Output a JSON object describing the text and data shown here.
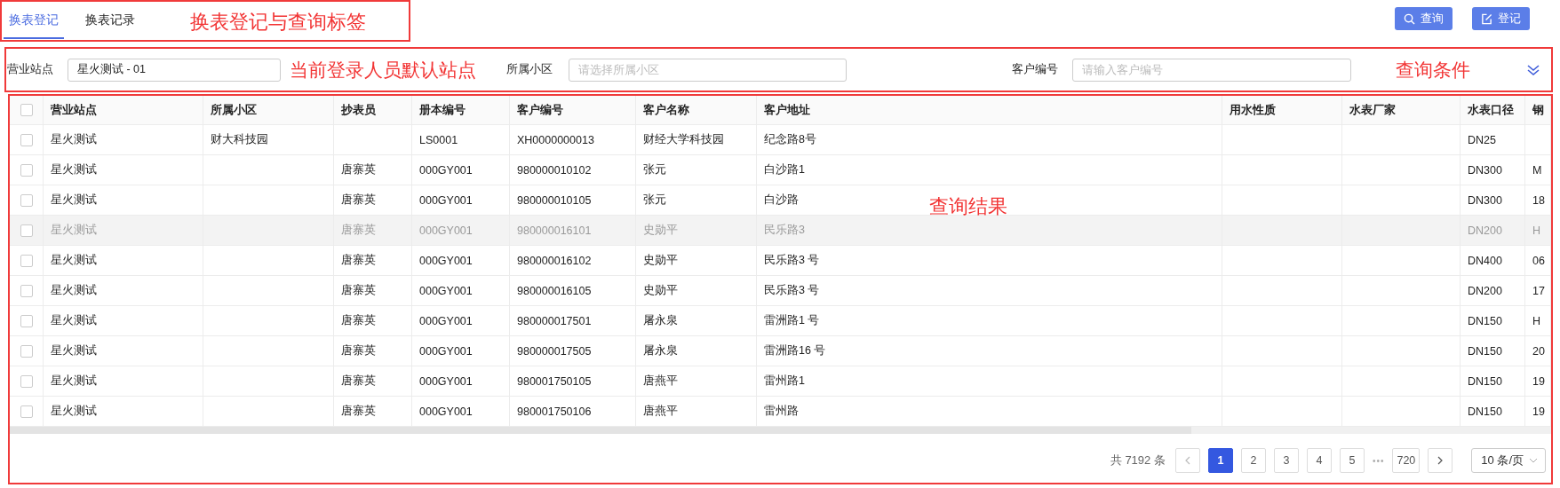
{
  "tab_bar": {
    "tabs": [
      {
        "label": "换表登记",
        "selected": true
      },
      {
        "label": "换表记录",
        "selected": false
      }
    ],
    "annotation": "换表登记与查询标签"
  },
  "buttons": [
    {
      "label": "查询",
      "kind": "search"
    },
    {
      "label": "登记",
      "kind": "register"
    }
  ],
  "filter_bar": {
    "filters": [
      {
        "label": "营业站点",
        "kind": "select",
        "value": "星火测试 - 01",
        "annotation": "当前登录人员默认站点"
      },
      {
        "label": "所属小区",
        "kind": "input",
        "placeholder": "请选择所属小区"
      },
      {
        "label": "客户编号",
        "kind": "input",
        "placeholder": "请输入客户编号"
      }
    ],
    "annotation": "查询条件"
  },
  "table": {
    "annotation": "查询结果",
    "all_checked": false,
    "columns": [
      "营业站点",
      "所属小区",
      "抄表员",
      "册本编号",
      "客户编号",
      "客户名称",
      "客户地址",
      "用水性质",
      "水表厂家",
      "水表口径",
      "钢"
    ],
    "rows": [
      {
        "checked": false,
        "highlighted": false,
        "cells": [
          "星火测试",
          "财大科技园",
          "",
          "LS0001",
          "XH0000000013",
          "财经大学科技园",
          "纪念路8号",
          "",
          "",
          "DN25",
          ""
        ]
      },
      {
        "checked": false,
        "highlighted": false,
        "cells": [
          "星火测试",
          "",
          "唐寨英",
          "000GY001",
          "980000010102",
          "张元",
          "白沙路1",
          "",
          "",
          "DN300",
          "M"
        ]
      },
      {
        "checked": false,
        "highlighted": false,
        "cells": [
          "星火测试",
          "",
          "唐寨英",
          "000GY001",
          "980000010105",
          "张元",
          "白沙路",
          "",
          "",
          "DN300",
          "18"
        ]
      },
      {
        "checked": false,
        "highlighted": true,
        "cells": [
          "星火测试",
          "",
          "唐寨英",
          "000GY001",
          "980000016101",
          "史勋平",
          "民乐路3",
          "",
          "",
          "DN200",
          "H"
        ]
      },
      {
        "checked": false,
        "highlighted": false,
        "cells": [
          "星火测试",
          "",
          "唐寨英",
          "000GY001",
          "980000016102",
          "史勋平",
          "民乐路3 号",
          "",
          "",
          "DN400",
          "06"
        ]
      },
      {
        "checked": false,
        "highlighted": false,
        "cells": [
          "星火测试",
          "",
          "唐寨英",
          "000GY001",
          "980000016105",
          "史勋平",
          "民乐路3 号",
          "",
          "",
          "DN200",
          "17"
        ]
      },
      {
        "checked": false,
        "highlighted": false,
        "cells": [
          "星火测试",
          "",
          "唐寨英",
          "000GY001",
          "980000017501",
          "屠永泉",
          "雷洲路1 号",
          "",
          "",
          "DN150",
          "H"
        ]
      },
      {
        "checked": false,
        "highlighted": false,
        "cells": [
          "星火测试",
          "",
          "唐寨英",
          "000GY001",
          "980000017505",
          "屠永泉",
          "雷洲路16 号",
          "",
          "",
          "DN150",
          "20"
        ]
      },
      {
        "checked": false,
        "highlighted": false,
        "cells": [
          "星火测试",
          "",
          "唐寨英",
          "000GY001",
          "980001750105",
          "唐燕平",
          "雷州路1",
          "",
          "",
          "DN150",
          "19"
        ]
      },
      {
        "checked": false,
        "highlighted": false,
        "cells": [
          "星火测试",
          "",
          "唐寨英",
          "000GY001",
          "980001750106",
          "唐燕平",
          "雷州路",
          "",
          "",
          "DN150",
          "19"
        ]
      }
    ]
  },
  "pagination": {
    "total": "共 7192 条",
    "pages": [
      {
        "kind": "page",
        "label": "1",
        "selected": true
      },
      {
        "kind": "page",
        "label": "2",
        "selected": false
      },
      {
        "kind": "page",
        "label": "3",
        "selected": false
      },
      {
        "kind": "page",
        "label": "4",
        "selected": false
      },
      {
        "kind": "page",
        "label": "5",
        "selected": false
      },
      {
        "kind": "ellipsis",
        "label": "•••"
      },
      {
        "kind": "page",
        "label": "720",
        "selected": false
      }
    ],
    "page_size": "10 条/页"
  }
}
